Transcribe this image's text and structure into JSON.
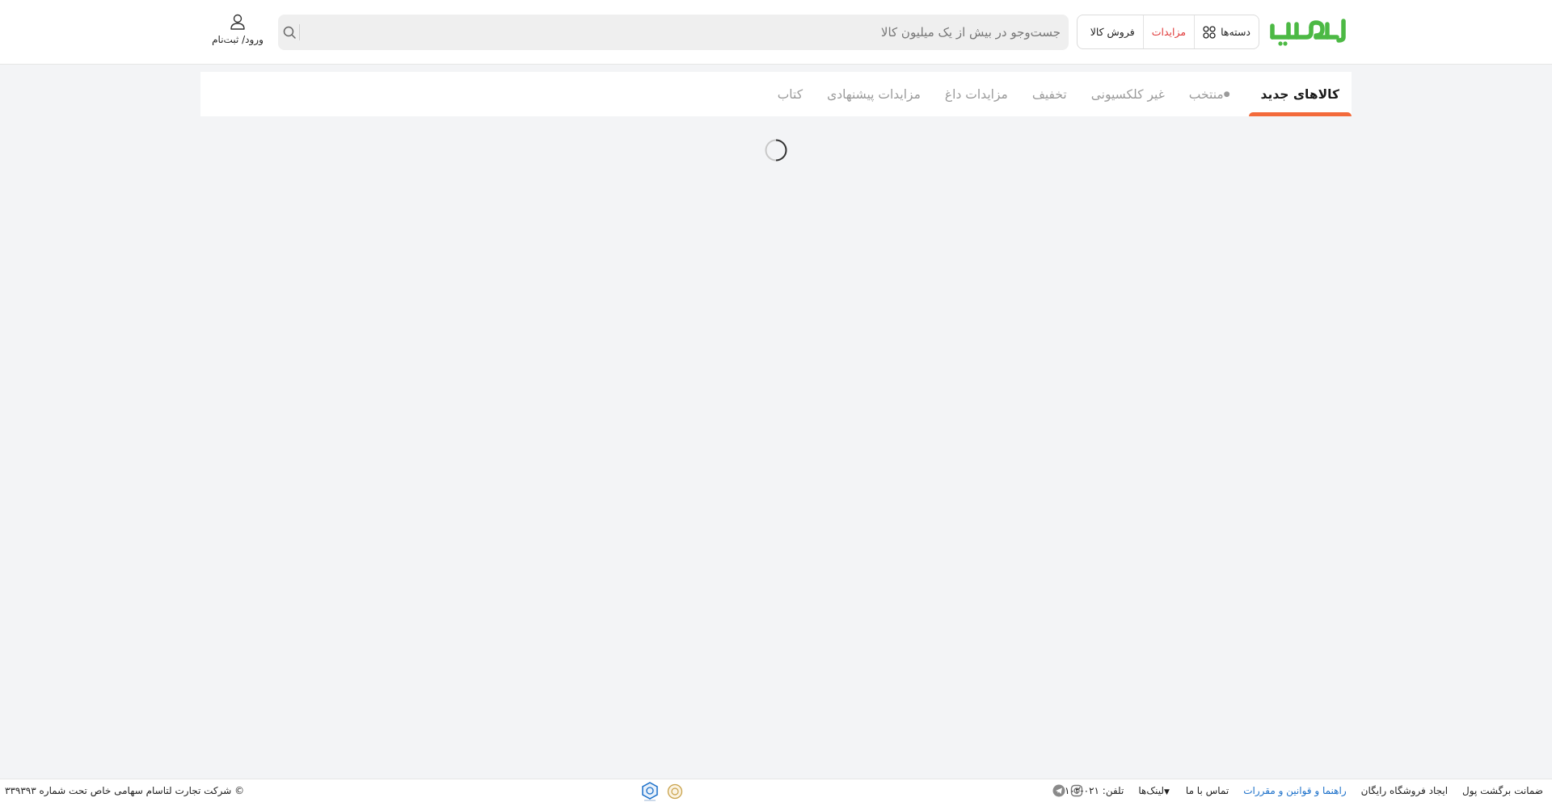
{
  "header": {
    "logo_text": "ایسام",
    "brand_color": "#4cb944",
    "nav": {
      "categories_label": "دسته‌ها",
      "auctions_label": "مزایدات",
      "sell_label": "فروش کالا"
    },
    "search": {
      "placeholder": "جست‌وجو در بیش از یک میلیون کالا",
      "value": ""
    },
    "login_label": "ورود/ ثبت‌نام"
  },
  "tabs": [
    {
      "label": "کالاهای جدید",
      "active": true
    },
    {
      "label": "منتخب",
      "active": false
    },
    {
      "label": "غیر کلکسیونی",
      "active": false
    },
    {
      "label": "تخفیف",
      "active": false
    },
    {
      "label": "مزایدات داغ",
      "active": false
    },
    {
      "label": "مزایدات پیشنهادی",
      "active": false
    },
    {
      "label": "کتاب",
      "active": false
    }
  ],
  "accent_color": "#f36a3b",
  "footer": {
    "links": [
      "ضمانت برگشت پول",
      "ایجاد فروشگاه رایگان",
      "راهنما و قوانین و مقررات",
      "تماس با ما",
      "لینک‌ها",
      "تلفن: ۰۲۱-۲۸۱۰۲"
    ],
    "social_icons": [
      "instagram-icon",
      "telegram-icon"
    ],
    "copyright": "© شرکت تجارت لتاسام سهامی خاص تحت شماره ۳۳۹۳۹۳"
  }
}
